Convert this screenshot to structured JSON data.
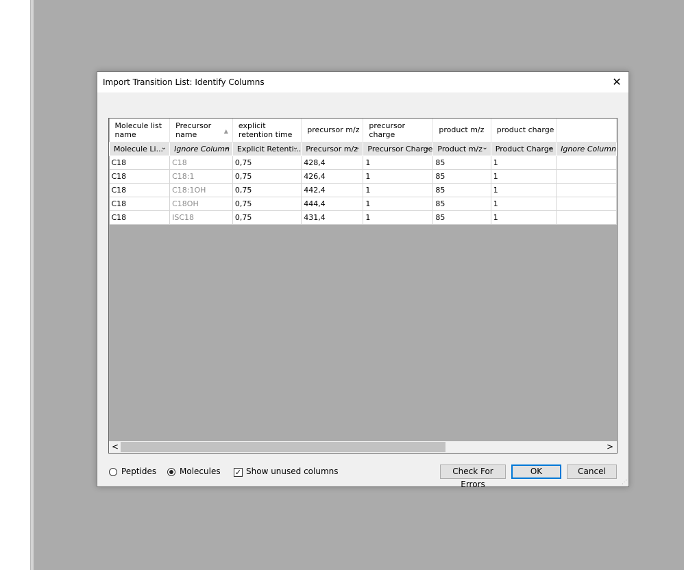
{
  "dialog": {
    "title": "Import Transition List: Identify Columns",
    "close_glyph": "✕"
  },
  "columns": [
    {
      "header": "Molecule list name",
      "combo": "Molecule Li...",
      "ignored": false
    },
    {
      "header": "Precursor name",
      "combo": "Ignore Column",
      "ignored": true
    },
    {
      "header": "explicit retention time",
      "combo": "Explicit Retenti...",
      "ignored": false
    },
    {
      "header": "precursor m/z",
      "combo": "Precursor m/z",
      "ignored": false
    },
    {
      "header": "precursor charge",
      "combo": "Precursor Charge",
      "ignored": false
    },
    {
      "header": "product m/z",
      "combo": "Product m/z",
      "ignored": false
    },
    {
      "header": "product charge",
      "combo": "Product Charge",
      "ignored": false
    },
    {
      "header": "",
      "combo": "Ignore Column",
      "ignored": true
    }
  ],
  "rows": [
    [
      "C18",
      "C18",
      "0,75",
      "428,4",
      "1",
      "85",
      "1",
      ""
    ],
    [
      "C18",
      "C18:1",
      "0,75",
      "426,4",
      "1",
      "85",
      "1",
      ""
    ],
    [
      "C18",
      "C18:1OH",
      "0,75",
      "442,4",
      "1",
      "85",
      "1",
      ""
    ],
    [
      "C18",
      "C18OH",
      "0,75",
      "444,4",
      "1",
      "85",
      "1",
      ""
    ],
    [
      "C18",
      "ISC18",
      "0,75",
      "431,4",
      "1",
      "85",
      "1",
      ""
    ]
  ],
  "scrollbar": {
    "left_arrow": "<",
    "right_arrow": ">"
  },
  "options": {
    "peptides_label": "Peptides",
    "molecules_label": "Molecules",
    "selected": "molecules",
    "show_unused_label": "Show unused columns",
    "show_unused_checked": true
  },
  "buttons": {
    "check_errors": "Check For Errors",
    "ok": "OK",
    "cancel": "Cancel"
  }
}
